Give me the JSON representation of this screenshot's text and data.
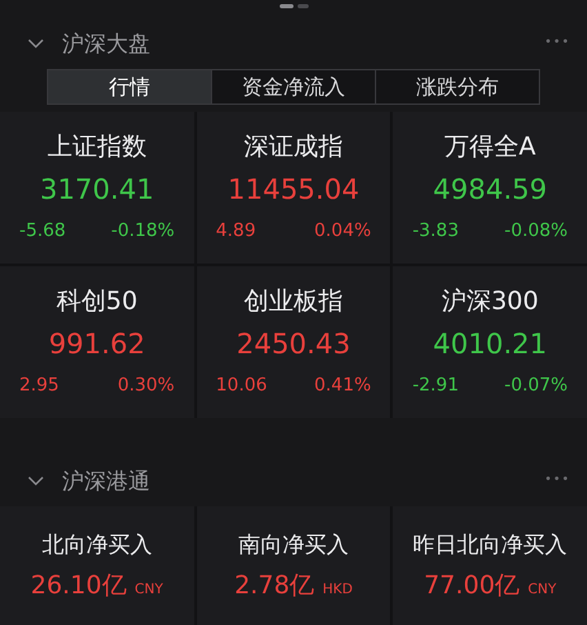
{
  "pages": [
    {
      "selected": true
    },
    {
      "selected": false
    }
  ],
  "sections": [
    {
      "title": "沪深大盘",
      "expanded": true,
      "more": "•••",
      "tabs": [
        {
          "label": "行情",
          "selected": true
        },
        {
          "label": "资金净流入",
          "selected": false
        },
        {
          "label": "涨跌分布",
          "selected": false
        }
      ],
      "kind": "index",
      "cells": [
        {
          "name": "上证指数",
          "value": "3170.41",
          "change": "-5.68",
          "percent": "-0.18%",
          "color": "#3fc64a"
        },
        {
          "name": "深证成指",
          "value": "11455.04",
          "change": "4.89",
          "percent": "0.04%",
          "color": "#e8403c"
        },
        {
          "name": "万得全A",
          "value": "4984.59",
          "change": "-3.83",
          "percent": "-0.08%",
          "color": "#3fc64a"
        },
        {
          "name": "科创50",
          "value": "991.62",
          "change": "2.95",
          "percent": "0.30%",
          "color": "#e8403c"
        },
        {
          "name": "创业板指",
          "value": "2450.43",
          "change": "10.06",
          "percent": "0.41%",
          "color": "#e8403c"
        },
        {
          "name": "沪深300",
          "value": "4010.21",
          "change": "-2.91",
          "percent": "-0.07%",
          "color": "#3fc64a"
        }
      ]
    },
    {
      "title": "沪深港通",
      "expanded": true,
      "more": "•••",
      "kind": "flow",
      "cells": [
        {
          "name": "北向净买入",
          "value": "26.10亿",
          "unit": "CNY",
          "color": "#e8403c"
        },
        {
          "name": "南向净买入",
          "value": "2.78亿",
          "unit": "HKD",
          "color": "#e8403c"
        },
        {
          "name": "昨日北向净买入",
          "value": "77.00亿",
          "unit": "CNY",
          "color": "#e8403c"
        }
      ]
    }
  ]
}
